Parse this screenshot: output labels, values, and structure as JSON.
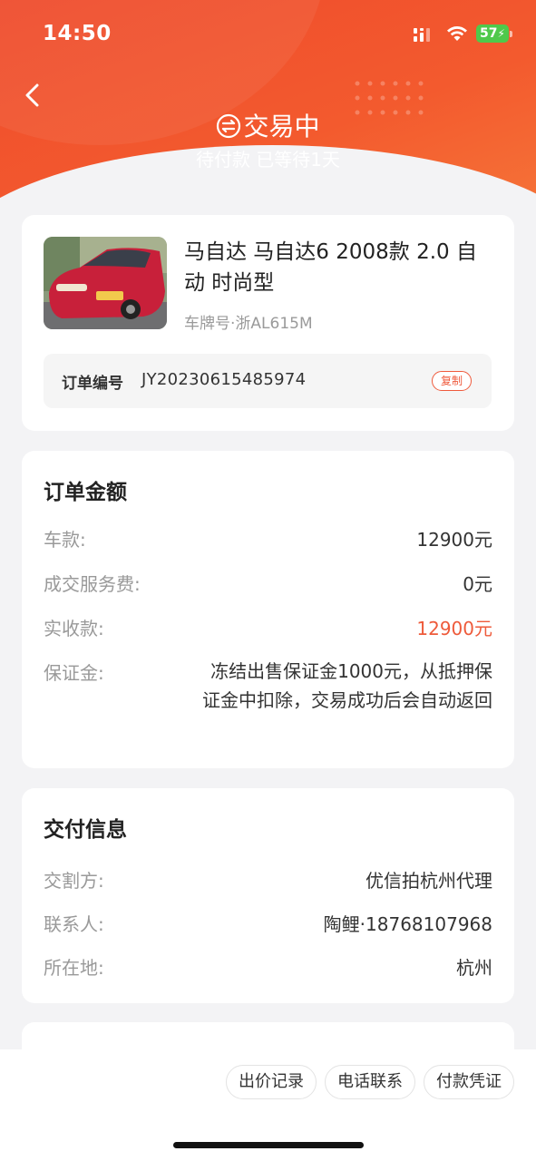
{
  "status_bar": {
    "time": "14:50",
    "battery": "57"
  },
  "header": {
    "title": "交易中",
    "subtitle": "待付款 已等待1天"
  },
  "car": {
    "title": "马自达 马自达6 2008款 2.0 自动 时尚型",
    "plate": "车牌号·浙AL615M",
    "order_label": "订单编号",
    "order_number": "JY20230615485974",
    "copy_label": "复制"
  },
  "amount": {
    "title": "订单金额",
    "rows": [
      {
        "label": "车款:",
        "value": "12900元"
      },
      {
        "label": "成交服务费:",
        "value": "0元"
      },
      {
        "label": "实收款:",
        "value": "12900元"
      },
      {
        "label": "保证金:",
        "value": "冻结出售保证金1000元，从抵押保证金中扣除，交易成功后会自动返回"
      }
    ]
  },
  "delivery": {
    "title": "交付信息",
    "rows": [
      {
        "label": "交割方:",
        "value": "优信拍杭州代理"
      },
      {
        "label": "联系人:",
        "value": "陶鲤·18768107968"
      },
      {
        "label": "所在地:",
        "value": "杭州"
      }
    ]
  },
  "actions": [
    "出价记录",
    "电话联系",
    "付款凭证"
  ],
  "colors": {
    "brand": "#ef4b2c",
    "accent_red": "#ee5a3a",
    "battery_green": "#4fc94b"
  }
}
